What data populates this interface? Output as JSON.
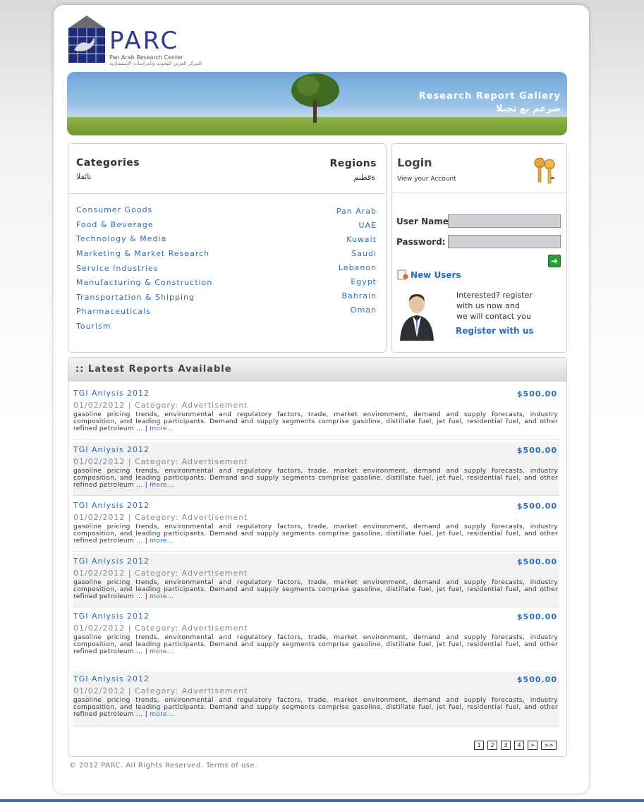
{
  "logo": {
    "text": "PARC",
    "subtitle": "Pan Arab Research Center",
    "subtitle_ar": "المركز العربي للبحوث والدراسات الإستشارية"
  },
  "banner": {
    "title": "Research Report Gallery",
    "subtitle_ar": "ضرعم نع ثحبلا"
  },
  "categories": {
    "title": "Categories",
    "title_ar": "تائفلا",
    "items": [
      "Consumer Goods",
      "Food & Beverage",
      "Technology & Media",
      "Marketing & Market Research",
      "Service Industries",
      "Manufacturing & Construction",
      "Transportation & Shipping",
      "Pharmaceuticals",
      "Tourism"
    ]
  },
  "regions": {
    "title": "Regions",
    "title_ar": "ةقطنم",
    "items": [
      "Pan Arab",
      "UAE",
      "Kuwait",
      "Saudi",
      "Lebanon",
      "Egypt",
      "Bahrain",
      "Oman"
    ]
  },
  "login": {
    "title": "Login",
    "subtitle": "View your Account",
    "username_label": "User Name:",
    "password_label": "Password:",
    "username_value": "",
    "password_value": "",
    "new_users": "New Users",
    "interested_line1": "Interested? register",
    "interested_line2": "with us now and",
    "interested_line3": "we will contact you",
    "register_link": "Register with us"
  },
  "reports": {
    "header": ":: Latest Reports Available",
    "items": [
      {
        "title": "TGI Anlysis 2012",
        "price": "$500.00",
        "meta": "01/02/2012 | Category: Advertisement",
        "desc": "gasoline pricing trends, environmental and regulatory factors, trade, market environment, demand and supply forecasts, industry composition, and leading participants. Demand and supply segments comprise gasoline, distillate fuel, jet fuel, residential fuel, and other refined petroleum ... |",
        "more": "more..."
      },
      {
        "title": "TGI Anlysis 2012",
        "price": "$500.00",
        "meta": "01/02/2012 | Category: Advertisement",
        "desc": "gasoline pricing trends, environmental and regulatory factors, trade, market environment, demand and supply forecasts, industry composition, and leading participants. Demand and supply segments comprise gasoline, distillate fuel, jet fuel, residential fuel, and other refined petroleum ... |",
        "more": "more..."
      },
      {
        "title": "TGI Anlysis 2012",
        "price": "$500.00",
        "meta": "01/02/2012 | Category: Advertisement",
        "desc": "gasoline pricing trends, environmental and regulatory factors, trade, market environment, demand and supply forecasts, industry composition, and leading participants. Demand and supply segments comprise gasoline, distillate fuel, jet fuel, residential fuel, and other refined petroleum ... |",
        "more": "more..."
      },
      {
        "title": "TGI Anlysis 2012",
        "price": "$500.00",
        "meta": "01/02/2012 | Category: Advertisement",
        "desc": "gasoline pricing trends, environmental and regulatory factors, trade, market environment, demand and supply forecasts, industry composition, and leading participants. Demand and supply segments comprise gasoline, distillate fuel, jet fuel, residential fuel, and other refined petroleum ... |",
        "more": "more..."
      },
      {
        "title": "TGI Anlysis 2012",
        "price": "$500.00",
        "meta": "01/02/2012 | Category: Advertisement",
        "desc": "gasoline pricing trends, environmental and regulatory factors, trade, market environment, demand and supply forecasts, industry composition, and leading participants. Demand and supply segments comprise gasoline, distillate fuel, jet fuel, residential fuel, and other refined petroleum ... |",
        "more": "more..."
      },
      {
        "title": "TGI Anlysis 2012",
        "price": "$500.00",
        "meta": "01/02/2012 | Category: Advertisement",
        "desc": "gasoline pricing trends, environmental and regulatory factors, trade, market environment, demand and supply forecasts, industry composition, and leading participants. Demand and supply segments comprise gasoline, distillate fuel, jet fuel, residential fuel, and other refined petroleum ... |",
        "more": "more..."
      }
    ]
  },
  "pagination": [
    "1",
    "2",
    "3",
    "4",
    ">",
    ">>"
  ],
  "footer": "© 2012 PARC. All Rights Reserved. Terms of use.",
  "colors": {
    "link": "#2a6dbd",
    "bottom_bar": "#3a6fb7"
  }
}
